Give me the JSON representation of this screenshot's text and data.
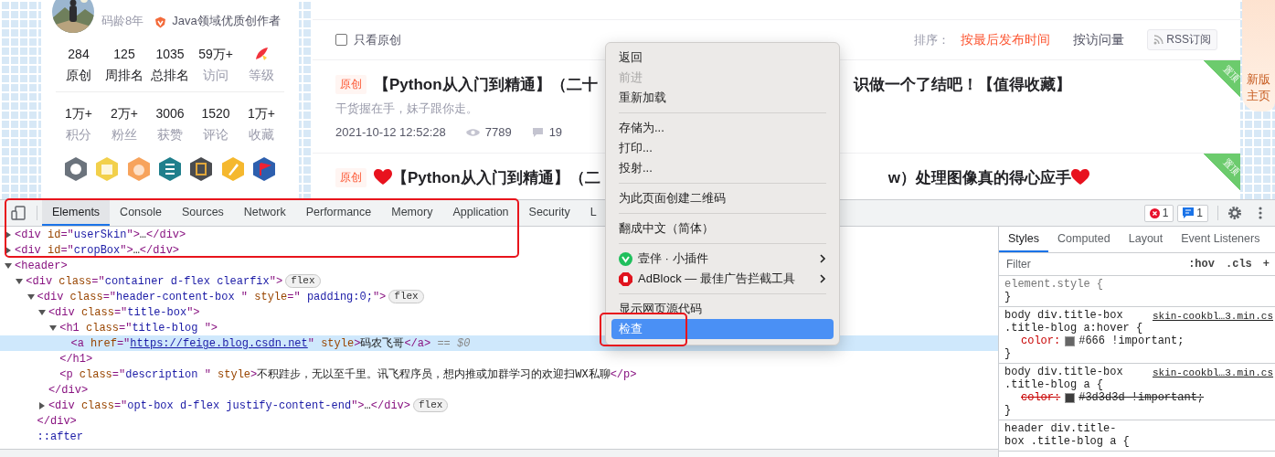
{
  "profile": {
    "coding_age": "码龄8年",
    "honor": "Java领域优质创作者",
    "stats_rows": [
      {
        "items": [
          {
            "kind": "value",
            "value": "284",
            "label": "原创",
            "strong": true
          },
          {
            "kind": "value",
            "value": "125",
            "label": "周排名",
            "strong": true
          },
          {
            "kind": "value",
            "value": "1035",
            "label": "总排名",
            "strong": true
          },
          {
            "kind": "value",
            "value": "59万+",
            "label": "访问",
            "strong": false
          },
          {
            "kind": "icon",
            "label": "等级",
            "strong": false
          }
        ]
      },
      {
        "items": [
          {
            "kind": "value",
            "value": "1万+",
            "label": "积分",
            "strong": false
          },
          {
            "kind": "value",
            "value": "2万+",
            "label": "粉丝",
            "strong": false
          },
          {
            "kind": "value",
            "value": "3006",
            "label": "获赞",
            "strong": false
          },
          {
            "kind": "value",
            "value": "1520",
            "label": "评论",
            "strong": false
          },
          {
            "kind": "value",
            "value": "1万+",
            "label": "收藏",
            "strong": false
          }
        ]
      }
    ],
    "badges": [
      {
        "kind": "github",
        "color": "#6b737c"
      },
      {
        "kind": "calendar",
        "color": "#f2d04b"
      },
      {
        "kind": "monkey",
        "color": "#f7a35c"
      },
      {
        "kind": "list",
        "color": "#1f7f8c"
      },
      {
        "kind": "seal",
        "color": "#4a4c50"
      },
      {
        "kind": "pen",
        "color": "#f5b82e"
      },
      {
        "kind": "flag",
        "color": "#2d5fae"
      }
    ]
  },
  "content": {
    "filter": {
      "label": "只看原创",
      "checked": false
    },
    "sort": {
      "label": "排序：",
      "options": [
        {
          "label": "按最后发布时间",
          "selected": true
        },
        {
          "label": "按访问量",
          "selected": false
        }
      ]
    },
    "rss": "RSS订阅",
    "articles": [
      {
        "tag": "原创",
        "heart_before": false,
        "title_start": "【Python从入门到精通】（二十",
        "title_end": "识做一个了结吧！【值得收藏】",
        "heart_after": false,
        "pinned": true,
        "pinned_label": "置顶",
        "description": "干货握在手，妹子跟你走。",
        "date": "2021-10-12 12:52:28",
        "views": "7789",
        "comments": "19"
      },
      {
        "tag": "原创",
        "heart_before": true,
        "title_start": "【Python从入门到精通】（二",
        "title_end": "w）处理图像真的得心应手",
        "heart_after": true,
        "pinned": true,
        "pinned_label": "置顶"
      }
    ]
  },
  "side_promo": {
    "label": "新版主页"
  },
  "context_menu": {
    "groups": [
      [
        {
          "label": "返回",
          "disabled": false,
          "selected": false
        },
        {
          "label": "前进",
          "disabled": true,
          "selected": false
        },
        {
          "label": "重新加载",
          "disabled": false,
          "selected": false
        }
      ],
      [
        {
          "label": "存储为...",
          "disabled": false,
          "selected": false
        },
        {
          "label": "打印...",
          "disabled": false,
          "selected": false
        },
        {
          "label": "投射...",
          "disabled": false,
          "selected": false
        }
      ],
      [
        {
          "label": "为此页面创建二维码",
          "disabled": false,
          "selected": false
        }
      ],
      [
        {
          "label": "翻成中文（简体）",
          "disabled": false,
          "selected": false
        }
      ],
      [
        {
          "label": "壹伴 · 小插件",
          "disabled": false,
          "selected": false,
          "kind": "extension",
          "submenu": true
        },
        {
          "label": "AdBlock — 最佳广告拦截工具",
          "disabled": false,
          "selected": false,
          "kind": "blocker",
          "submenu": true
        }
      ],
      [
        {
          "label": "显示网页源代码",
          "disabled": false,
          "selected": false
        },
        {
          "label": "检查",
          "disabled": false,
          "selected": true
        }
      ]
    ]
  },
  "devtools": {
    "tabs": [
      {
        "label": "Elements",
        "selected": true
      },
      {
        "label": "Console",
        "selected": false
      },
      {
        "label": "Sources",
        "selected": false
      },
      {
        "label": "Network",
        "selected": false
      },
      {
        "label": "Performance",
        "selected": false
      },
      {
        "label": "Memory",
        "selected": false
      },
      {
        "label": "Application",
        "selected": false
      },
      {
        "label": "Security",
        "selected": false
      },
      {
        "label": "L",
        "selected": false
      }
    ],
    "errors": "1",
    "messages": "1",
    "dom": [
      {
        "selected": false,
        "expanded": false,
        "segments": [
          {
            "kind": "tag",
            "s": "<div"
          },
          {
            "kind": "attr",
            "s": " id"
          },
          {
            "kind": "tag",
            "s": "=\""
          },
          {
            "kind": "value",
            "s": "userSkin"
          },
          {
            "kind": "tag",
            "s": "\">"
          },
          {
            "kind": "text",
            "s": "…"
          },
          {
            "kind": "tag",
            "s": "</div>"
          }
        ]
      },
      {
        "selected": false,
        "expanded": false,
        "segments": [
          {
            "kind": "tag",
            "s": "<div"
          },
          {
            "kind": "attr",
            "s": " id"
          },
          {
            "kind": "tag",
            "s": "=\""
          },
          {
            "kind": "value",
            "s": "cropBox"
          },
          {
            "kind": "tag",
            "s": "\">"
          },
          {
            "kind": "text",
            "s": "…"
          },
          {
            "kind": "tag",
            "s": "</div>"
          }
        ]
      },
      {
        "selected": false,
        "expanded": true,
        "segments": [
          {
            "kind": "tag",
            "s": "<header>"
          }
        ],
        "children": [
          {
            "selected": false,
            "expanded": true,
            "badge": "flex",
            "segments": [
              {
                "kind": "tag",
                "s": "<div"
              },
              {
                "kind": "attr",
                "s": " class"
              },
              {
                "kind": "tag",
                "s": "=\""
              },
              {
                "kind": "value",
                "s": "container d-flex clearfix"
              },
              {
                "kind": "tag",
                "s": "\">"
              }
            ],
            "children": [
              {
                "selected": false,
                "expanded": true,
                "badge": "flex",
                "segments": [
                  {
                    "kind": "tag",
                    "s": "<div"
                  },
                  {
                    "kind": "attr",
                    "s": " class"
                  },
                  {
                    "kind": "tag",
                    "s": "=\""
                  },
                  {
                    "kind": "value",
                    "s": "header-content-box "
                  },
                  {
                    "kind": "tag",
                    "s": "\""
                  },
                  {
                    "kind": "attr",
                    "s": " style"
                  },
                  {
                    "kind": "tag",
                    "s": "=\""
                  },
                  {
                    "kind": "value",
                    "s": " padding:0;"
                  },
                  {
                    "kind": "tag",
                    "s": "\">"
                  }
                ],
                "children": [
                  {
                    "selected": false,
                    "expanded": true,
                    "segments": [
                      {
                        "kind": "tag",
                        "s": "<div"
                      },
                      {
                        "kind": "attr",
                        "s": " class"
                      },
                      {
                        "kind": "tag",
                        "s": "=\""
                      },
                      {
                        "kind": "value",
                        "s": "title-box"
                      },
                      {
                        "kind": "tag",
                        "s": "\">"
                      }
                    ],
                    "children": [
                      {
                        "selected": false,
                        "expanded": true,
                        "segments": [
                          {
                            "kind": "tag",
                            "s": "<h1"
                          },
                          {
                            "kind": "attr",
                            "s": " class"
                          },
                          {
                            "kind": "tag",
                            "s": "=\""
                          },
                          {
                            "kind": "value",
                            "s": "title-blog "
                          },
                          {
                            "kind": "tag",
                            "s": "\">"
                          }
                        ],
                        "children": [
                          {
                            "selected": true,
                            "segments": [
                              {
                                "kind": "tag",
                                "s": "<a"
                              },
                              {
                                "kind": "attr",
                                "s": " href"
                              },
                              {
                                "kind": "tag",
                                "s": "=\""
                              },
                              {
                                "kind": "link",
                                "s": "https://feige.blog.csdn.net"
                              },
                              {
                                "kind": "tag",
                                "s": "\""
                              },
                              {
                                "kind": "attr",
                                "s": " style"
                              },
                              {
                                "kind": "tag",
                                "s": ">"
                              },
                              {
                                "kind": "text",
                                "s": "码农飞哥"
                              },
                              {
                                "kind": "tag",
                                "s": "</a>"
                              },
                              {
                                "kind": "muted",
                                "s": " == $0"
                              }
                            ]
                          }
                        ],
                        "closing": [
                          {
                            "kind": "tag",
                            "s": "</h1>"
                          }
                        ]
                      },
                      {
                        "selected": false,
                        "segments": [
                          {
                            "kind": "tag",
                            "s": "<p"
                          },
                          {
                            "kind": "attr",
                            "s": " class"
                          },
                          {
                            "kind": "tag",
                            "s": "=\""
                          },
                          {
                            "kind": "value",
                            "s": "description "
                          },
                          {
                            "kind": "tag",
                            "s": "\""
                          },
                          {
                            "kind": "attr",
                            "s": " style"
                          },
                          {
                            "kind": "tag",
                            "s": ">"
                          },
                          {
                            "kind": "text",
                            "s": "不积跬步，无以至千里。讯飞程序员，想内推或加群学习的欢迎扫WX私聊"
                          },
                          {
                            "kind": "tag",
                            "s": "</p>"
                          }
                        ]
                      }
                    ],
                    "closing": [
                      {
                        "kind": "tag",
                        "s": "</div>"
                      }
                    ]
                  },
                  {
                    "selected": false,
                    "expanded": false,
                    "badge": "flex",
                    "segments": [
                      {
                        "kind": "tag",
                        "s": "<div"
                      },
                      {
                        "kind": "attr",
                        "s": " class"
                      },
                      {
                        "kind": "tag",
                        "s": "=\""
                      },
                      {
                        "kind": "value",
                        "s": "opt-box d-flex justify-content-end"
                      },
                      {
                        "kind": "tag",
                        "s": "\">"
                      },
                      {
                        "kind": "text",
                        "s": "…"
                      },
                      {
                        "kind": "tag",
                        "s": "</div>"
                      }
                    ]
                  }
                ],
                "closing": [
                  {
                    "kind": "tag",
                    "s": "</div>"
                  }
                ]
              },
              {
                "selected": false,
                "segments": [
                  {
                    "kind": "pseudo",
                    "s": "::after"
                  }
                ]
              }
            ]
          }
        ]
      }
    ],
    "styles": {
      "tabs": [
        {
          "label": "Styles",
          "selected": true
        },
        {
          "label": "Computed",
          "selected": false
        },
        {
          "label": "Layout",
          "selected": false
        },
        {
          "label": "Event Listeners",
          "selected": false
        }
      ],
      "filter_placeholder": "Filter",
      "tools": [
        ":hov",
        ".cls",
        "+"
      ],
      "rules": [
        {
          "kind": "inline",
          "selector_lines": [
            "element.style {"
          ],
          "closing": "}"
        },
        {
          "kind": "sheet",
          "selector_lines": [
            "body div.title-box",
            ".title-blog a:hover {"
          ],
          "source": "skin-cookbl…3.min.cs",
          "declarations": [
            {
              "property": "color:",
              "value": "#666 !important;",
              "color": "#666666",
              "struck": false
            }
          ],
          "closing": "}"
        },
        {
          "kind": "sheet",
          "selector_lines": [
            "body div.title-box",
            ".title-blog a {"
          ],
          "source": "skin-cookbl…3.min.cs",
          "declarations": [
            {
              "property": "color:",
              "value": "#3d3d3d !important;",
              "color": "#3d3d3d",
              "struck": true
            }
          ],
          "closing": "}"
        },
        {
          "kind": "sheet",
          "selector_lines": [
            "header div.title-",
            "box .title-blog a {"
          ]
        }
      ]
    }
  }
}
